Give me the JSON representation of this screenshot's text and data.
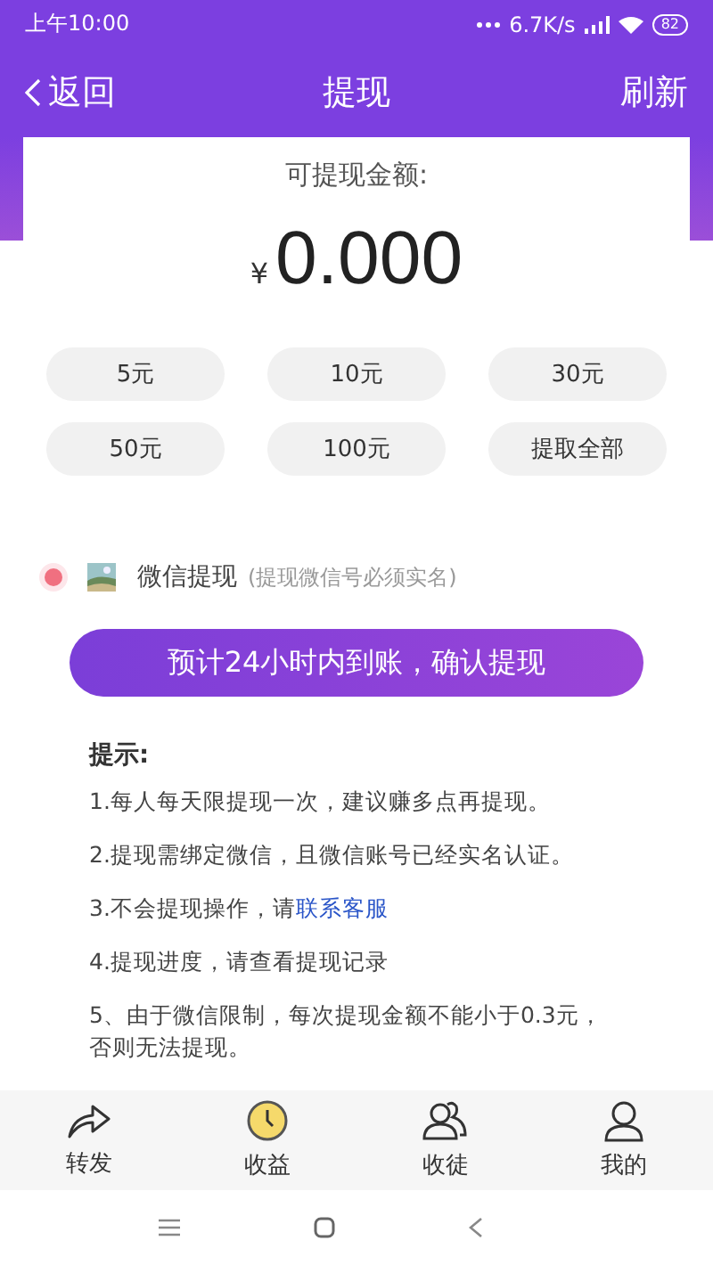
{
  "status_bar": {
    "time": "上午10:00",
    "speed": "6.7K/s",
    "battery": "82"
  },
  "header": {
    "back": "返回",
    "title": "提现",
    "action": "刷新"
  },
  "balance": {
    "label": "可提现金额:",
    "currency": "¥",
    "amount": "0.000"
  },
  "amounts": [
    {
      "label": "5元",
      "selected": false
    },
    {
      "label": "10元",
      "selected": false
    },
    {
      "label": "30元",
      "selected": false
    },
    {
      "label": "50元",
      "selected": false
    },
    {
      "label": "100元",
      "selected": false
    },
    {
      "label": "提取全部",
      "selected": false
    }
  ],
  "method": {
    "label": "微信提现",
    "note": "(提现微信号必须实名)",
    "selected": true
  },
  "confirm_button": "预计24小时内到账，确认提现",
  "tips": {
    "title": "提示:",
    "items": [
      {
        "text": "1.每人每天限提现一次，建议赚多点再提现。"
      },
      {
        "text": "2.提现需绑定微信，且微信账号已经实名认证。"
      },
      {
        "text": "3.不会提现操作，请",
        "link": "联系客服"
      },
      {
        "text": "4.提现进度，请查看提现记录"
      },
      {
        "text": "5、由于微信限制，每次提现金额不能小于0.3元，否则无法提现。"
      }
    ]
  },
  "tabs": [
    {
      "kind": "share",
      "label": "转发",
      "selected": false
    },
    {
      "kind": "earnings",
      "label": "收益",
      "selected": true
    },
    {
      "kind": "recruit",
      "label": "收徒",
      "selected": false
    },
    {
      "kind": "profile",
      "label": "我的",
      "selected": false
    }
  ]
}
